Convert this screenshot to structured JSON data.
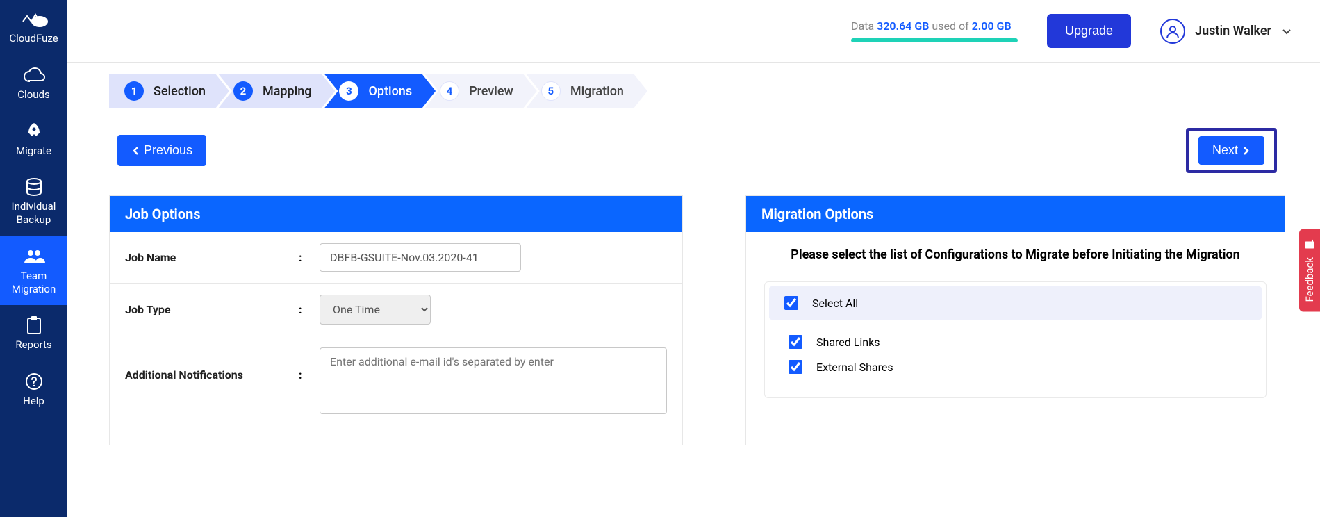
{
  "brand": "CloudFuze",
  "sidebar": {
    "items": [
      {
        "label": "CloudFuze"
      },
      {
        "label": "Clouds"
      },
      {
        "label": "Migrate"
      },
      {
        "label": "Individual\nBackup"
      },
      {
        "label": "Team\nMigration"
      },
      {
        "label": "Reports"
      },
      {
        "label": "Help"
      }
    ]
  },
  "header": {
    "data_prefix": "Data ",
    "data_used": "320.64 GB",
    "data_middle": " used of ",
    "data_limit": "2.00 GB",
    "upgrade_label": "Upgrade",
    "user_name": "Justin Walker"
  },
  "stepper": [
    {
      "num": "1",
      "label": "Selection"
    },
    {
      "num": "2",
      "label": "Mapping"
    },
    {
      "num": "3",
      "label": "Options"
    },
    {
      "num": "4",
      "label": "Preview"
    },
    {
      "num": "5",
      "label": "Migration"
    }
  ],
  "nav": {
    "previous": "Previous",
    "next": "Next"
  },
  "job_options": {
    "title": "Job Options",
    "job_name_label": "Job Name",
    "job_name_value": "DBFB-GSUITE-Nov.03.2020-41",
    "job_type_label": "Job Type",
    "job_type_value": "One Time",
    "notifications_label": "Additional Notifications",
    "notifications_placeholder": "Enter additional e-mail id's separated by enter"
  },
  "migration_options": {
    "title": "Migration Options",
    "prompt": "Please select the list of Configurations to Migrate before Initiating the Migration",
    "select_all": "Select All",
    "items": [
      {
        "label": "Shared Links"
      },
      {
        "label": "External Shares"
      }
    ]
  },
  "feedback_label": "Feedback"
}
